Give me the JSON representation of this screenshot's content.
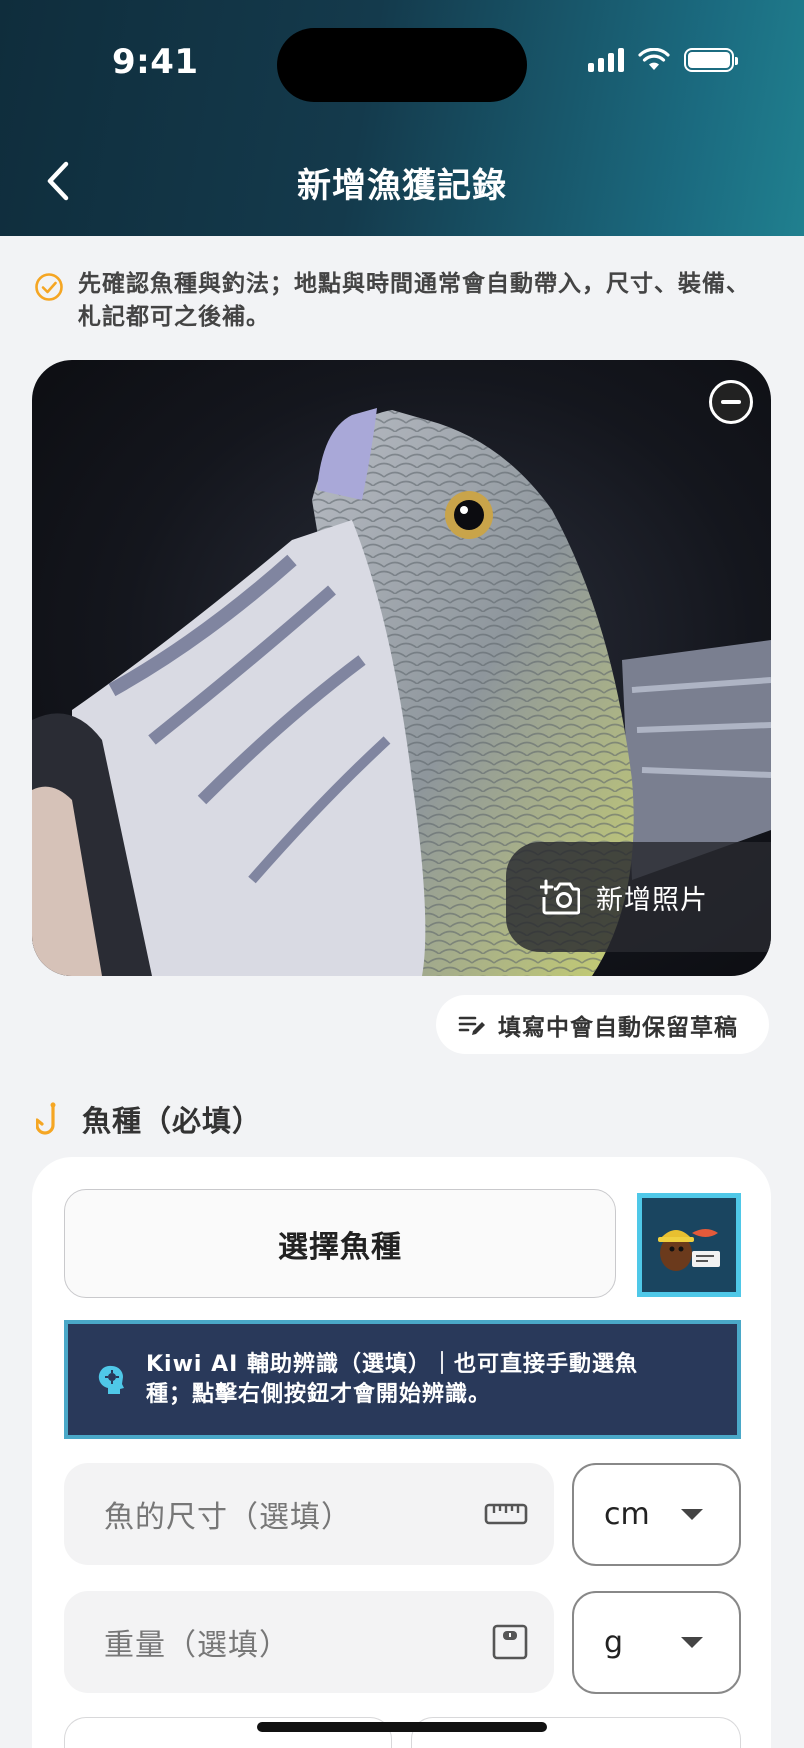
{
  "status_bar": {
    "time": "9:41"
  },
  "header": {
    "title": "新增漁獲記錄"
  },
  "tip": {
    "text": "先確認魚種與釣法；地點與時間通常會自動帶入，尺寸、裝備、札記都可之後補。"
  },
  "photo": {
    "add_photo_label": "新增照片"
  },
  "draft_notice": "填寫中會自動保留草稿",
  "species_section": {
    "title": "魚種（必填）",
    "choose_label": "選擇魚種",
    "ai_banner": "Kiwi AI 輔助辨識（選填）｜也可直接手動選魚種；點擊右側按鈕才會開始辨識。"
  },
  "size_field": {
    "placeholder": "魚的尺寸（選填）",
    "unit": "cm"
  },
  "weight_field": {
    "placeholder": "重量（選填）",
    "unit": "g"
  },
  "colors": {
    "header_start": "#0f2d3c",
    "header_end": "#20808f",
    "accent_orange": "#f5a623",
    "ai_banner_bg": "#29395a",
    "ai_border": "#4fc8e8"
  }
}
